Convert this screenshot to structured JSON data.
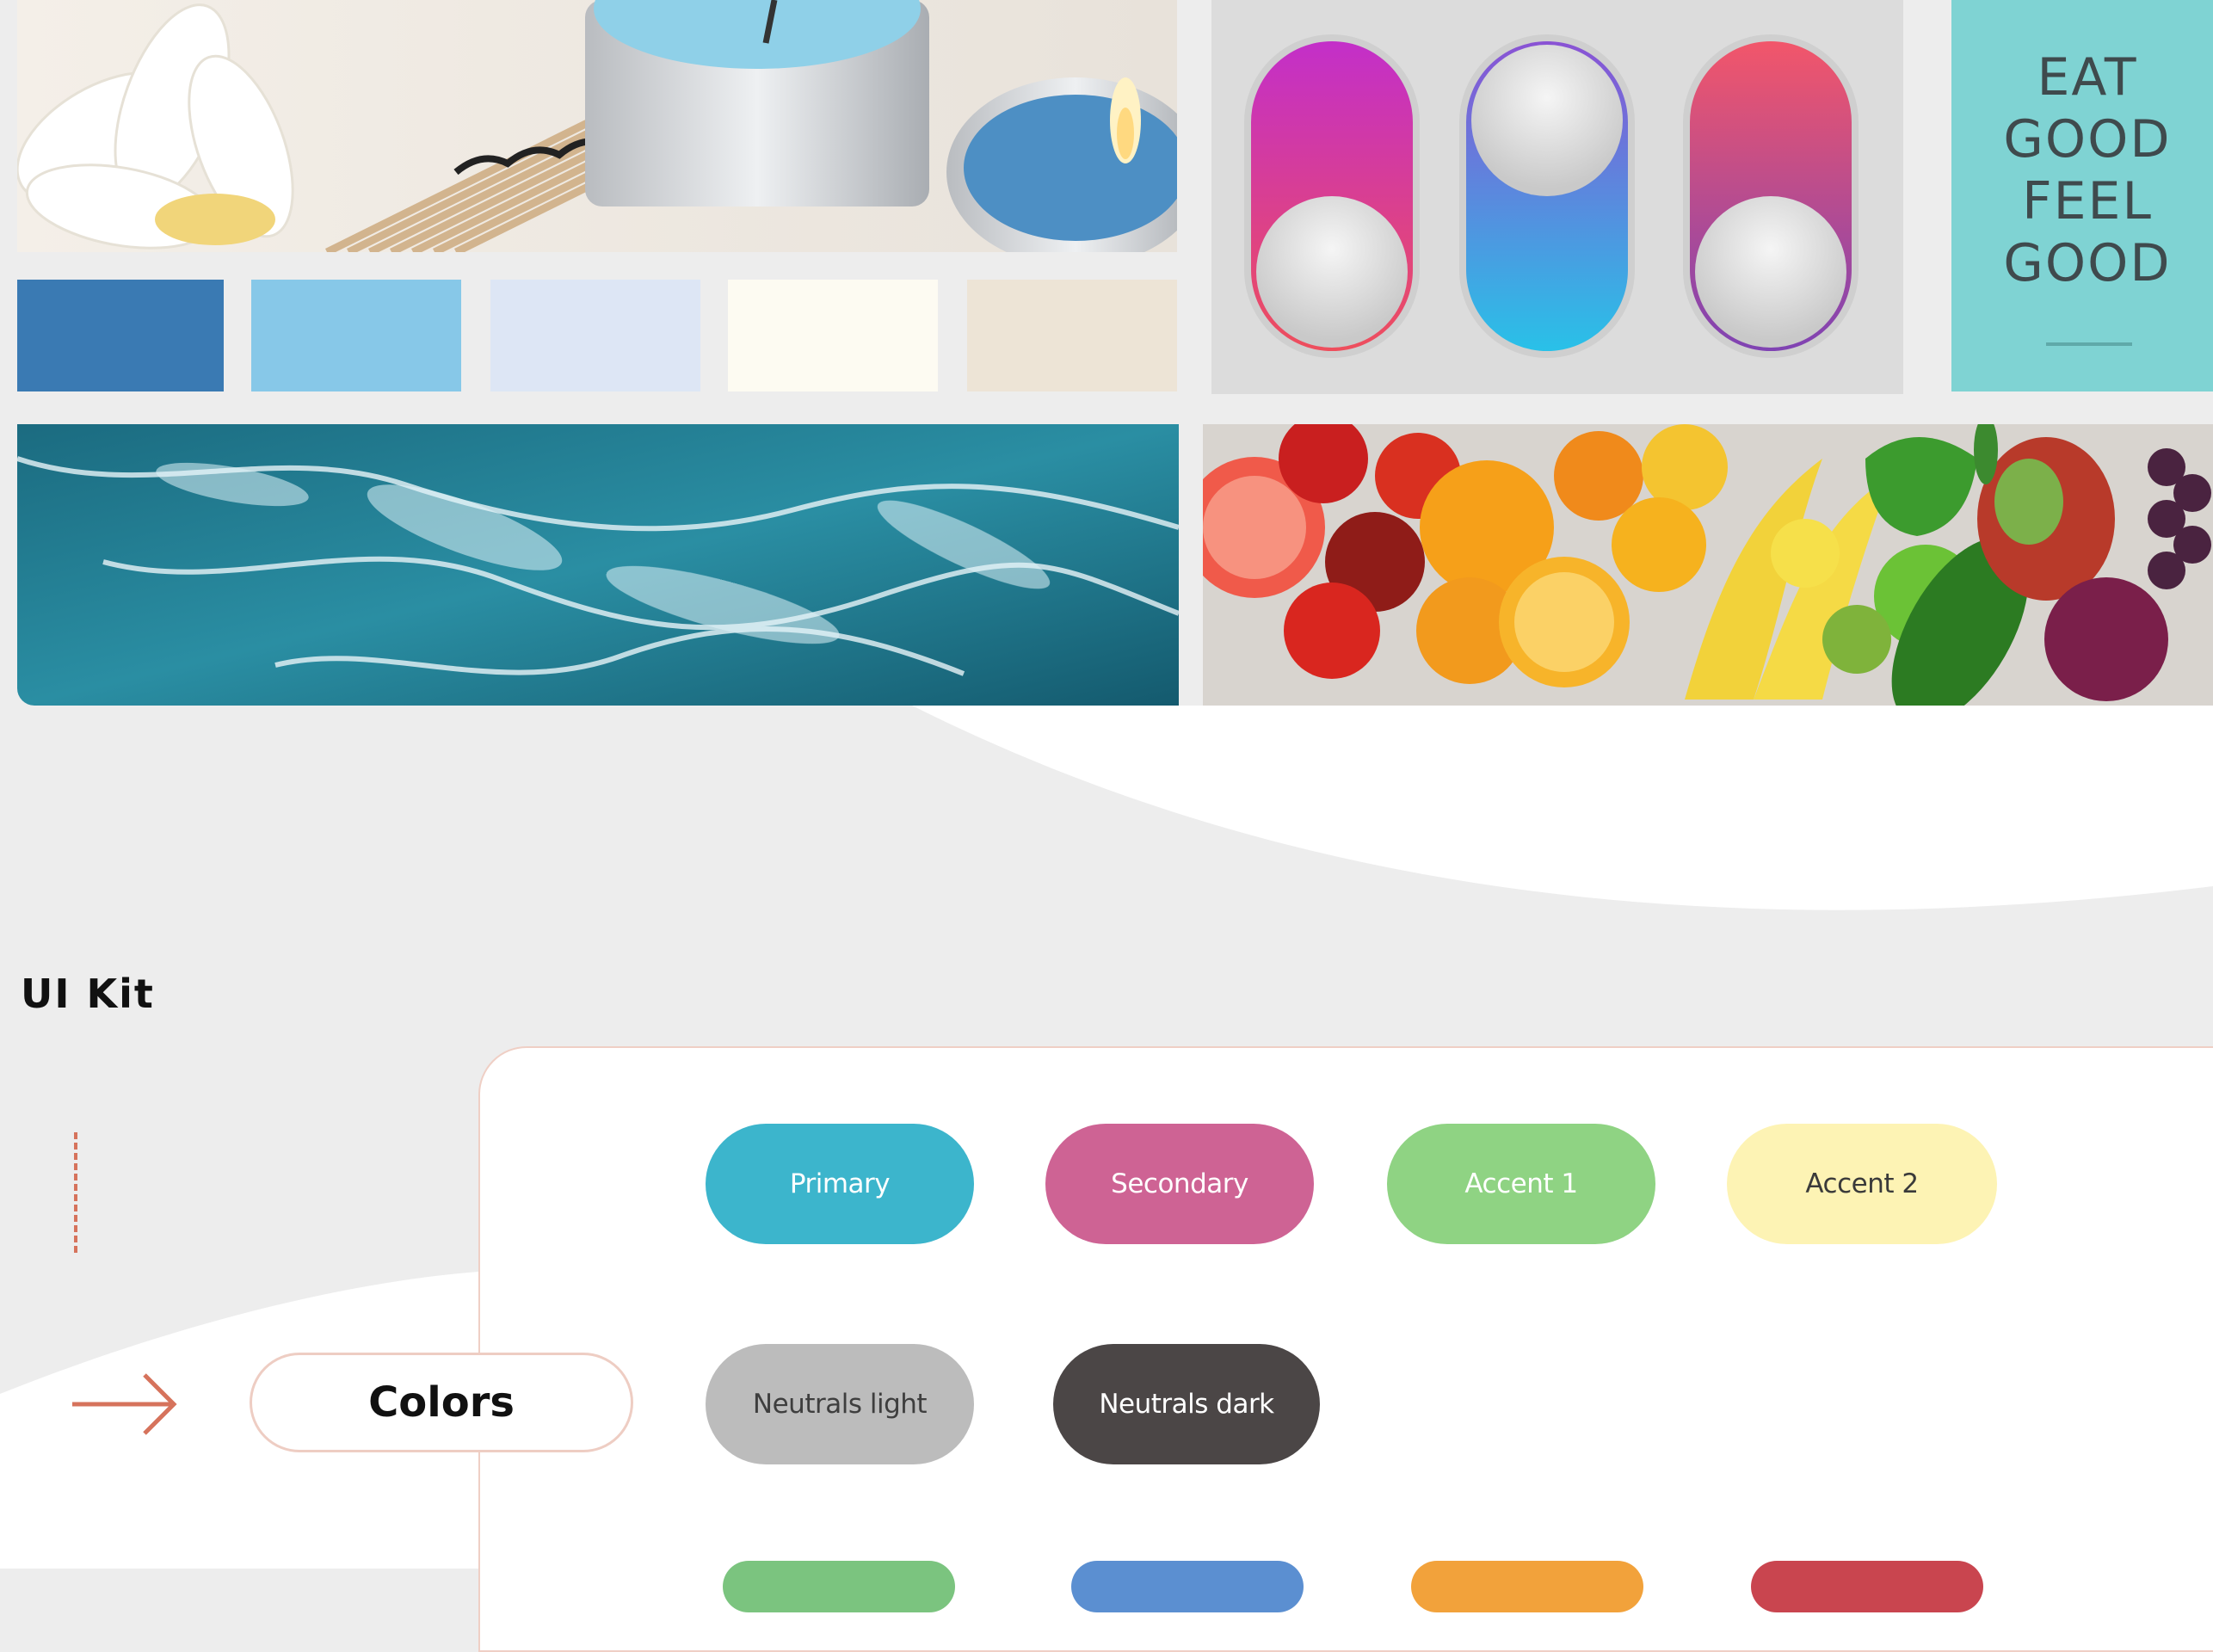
{
  "moodboard": {
    "palette": [
      "#3a7ab3",
      "#87c8e8",
      "#dde6f5",
      "#fdfbf2",
      "#ede4d6"
    ],
    "poster": {
      "lines": [
        "EAT",
        "GOOD",
        "FEEL",
        "GOOD"
      ],
      "color": "#7fd3d3"
    }
  },
  "ui_kit": {
    "title": "UI Kit",
    "active_tab": "Colors",
    "color_buttons": [
      {
        "label": "Primary",
        "bg": "#3cb5cc",
        "fg": "#ffffff"
      },
      {
        "label": "Secondary",
        "bg": "#ce6394",
        "fg": "#ffffff"
      },
      {
        "label": "Accent 1",
        "bg": "#8fd383",
        "fg": "#ffffff"
      },
      {
        "label": "Accent 2",
        "bg": "#fdf3b4",
        "fg": "#3a3a3a"
      },
      {
        "label": "Neutrals light",
        "bg": "#bcbcbc",
        "fg": "#3e3e3e"
      },
      {
        "label": "Neutrals dark",
        "bg": "#4b4646",
        "fg": "#ffffff"
      }
    ],
    "partial_buttons": [
      "#7bc47f",
      "#5b8fd1",
      "#f2a23b",
      "#c9454f"
    ],
    "accent_color": "#d6735c"
  }
}
